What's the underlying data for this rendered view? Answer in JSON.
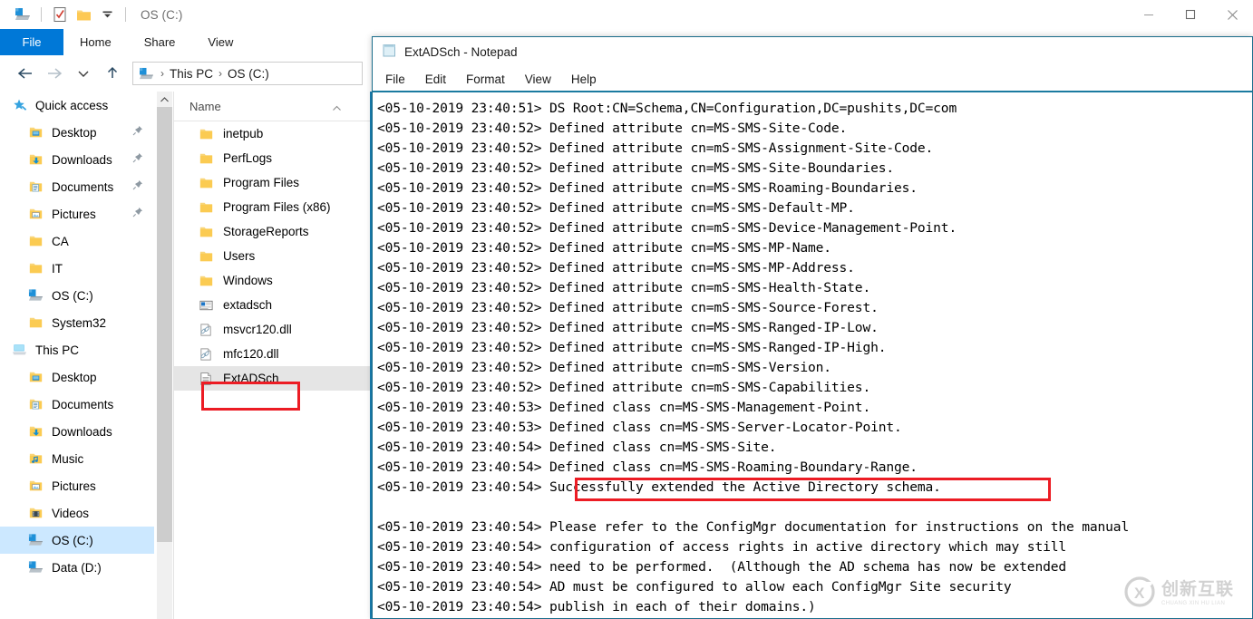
{
  "explorer": {
    "title": "OS (C:)",
    "quick_access_toolbar": [
      {
        "name": "drive-icon",
        "label": "OS (C:)"
      },
      {
        "name": "properties-icon",
        "label": "Properties"
      },
      {
        "name": "new-folder-icon",
        "label": "New folder"
      },
      {
        "name": "customize-dropdown-icon",
        "label": "Customize Quick Access Toolbar"
      }
    ],
    "window_controls": {
      "minimize": "—",
      "maximize": "□",
      "close": "✕"
    },
    "ribbon_tabs": [
      {
        "label": "File",
        "active": true
      },
      {
        "label": "Home",
        "active": false
      },
      {
        "label": "Share",
        "active": false
      },
      {
        "label": "View",
        "active": false
      }
    ],
    "address_bar": {
      "back": "Back",
      "forward": "Forward",
      "recent": "Recent locations",
      "up": "Up",
      "breadcrumbs": [
        "This PC",
        "OS (C:)"
      ],
      "separator": "›"
    },
    "navigation_pane": [
      {
        "label": "Quick access",
        "icon": "star-icon",
        "indent": 0,
        "pinned": false,
        "selected": false
      },
      {
        "label": "Desktop",
        "icon": "desktop-folder-icon",
        "indent": 1,
        "pinned": true,
        "selected": false
      },
      {
        "label": "Downloads",
        "icon": "downloads-folder-icon",
        "indent": 1,
        "pinned": true,
        "selected": false
      },
      {
        "label": "Documents",
        "icon": "documents-folder-icon",
        "indent": 1,
        "pinned": true,
        "selected": false
      },
      {
        "label": "Pictures",
        "icon": "pictures-folder-icon",
        "indent": 1,
        "pinned": true,
        "selected": false
      },
      {
        "label": "CA",
        "icon": "folder-icon",
        "indent": 1,
        "pinned": false,
        "selected": false
      },
      {
        "label": "IT",
        "icon": "folder-icon",
        "indent": 1,
        "pinned": false,
        "selected": false
      },
      {
        "label": "OS (C:)",
        "icon": "drive-icon",
        "indent": 1,
        "pinned": false,
        "selected": false
      },
      {
        "label": "System32",
        "icon": "folder-icon",
        "indent": 1,
        "pinned": false,
        "selected": false
      },
      {
        "label": "This PC",
        "icon": "thispc-icon",
        "indent": 0,
        "pinned": false,
        "selected": false
      },
      {
        "label": "Desktop",
        "icon": "desktop-folder-icon",
        "indent": 1,
        "pinned": false,
        "selected": false
      },
      {
        "label": "Documents",
        "icon": "documents-folder-icon",
        "indent": 1,
        "pinned": false,
        "selected": false
      },
      {
        "label": "Downloads",
        "icon": "downloads-folder-icon",
        "indent": 1,
        "pinned": false,
        "selected": false
      },
      {
        "label": "Music",
        "icon": "music-folder-icon",
        "indent": 1,
        "pinned": false,
        "selected": false
      },
      {
        "label": "Pictures",
        "icon": "pictures-folder-icon",
        "indent": 1,
        "pinned": false,
        "selected": false
      },
      {
        "label": "Videos",
        "icon": "videos-folder-icon",
        "indent": 1,
        "pinned": false,
        "selected": false
      },
      {
        "label": "OS (C:)",
        "icon": "drive-icon",
        "indent": 1,
        "pinned": false,
        "selected": true
      },
      {
        "label": "Data (D:)",
        "icon": "drive-icon",
        "indent": 1,
        "pinned": false,
        "selected": false
      }
    ],
    "file_list": {
      "column_header": "Name",
      "sort_indicator": "ascending",
      "items": [
        {
          "label": "inetpub",
          "icon": "folder-icon",
          "selected": false,
          "highlighted": false
        },
        {
          "label": "PerfLogs",
          "icon": "folder-icon",
          "selected": false,
          "highlighted": false
        },
        {
          "label": "Program Files",
          "icon": "folder-icon",
          "selected": false,
          "highlighted": false
        },
        {
          "label": "Program Files (x86)",
          "icon": "folder-icon",
          "selected": false,
          "highlighted": false
        },
        {
          "label": "StorageReports",
          "icon": "folder-icon",
          "selected": false,
          "highlighted": false
        },
        {
          "label": "Users",
          "icon": "folder-icon",
          "selected": false,
          "highlighted": false
        },
        {
          "label": "Windows",
          "icon": "folder-icon",
          "selected": false,
          "highlighted": false
        },
        {
          "label": "extadsch",
          "icon": "application-icon",
          "selected": false,
          "highlighted": false
        },
        {
          "label": "msvcr120.dll",
          "icon": "dll-icon",
          "selected": false,
          "highlighted": false
        },
        {
          "label": "mfc120.dll",
          "icon": "dll-icon",
          "selected": false,
          "highlighted": false
        },
        {
          "label": "ExtADSch",
          "icon": "textfile-icon",
          "selected": true,
          "highlighted": true
        }
      ]
    }
  },
  "notepad": {
    "title": "ExtADSch - Notepad",
    "icon": "notepad-icon",
    "menu": [
      "File",
      "Edit",
      "Format",
      "View",
      "Help"
    ],
    "highlight_line_index": 19,
    "lines": [
      "<05-10-2019 23:40:51> DS Root:CN=Schema,CN=Configuration,DC=pushits,DC=com",
      "<05-10-2019 23:40:52> Defined attribute cn=MS-SMS-Site-Code.",
      "<05-10-2019 23:40:52> Defined attribute cn=mS-SMS-Assignment-Site-Code.",
      "<05-10-2019 23:40:52> Defined attribute cn=MS-SMS-Site-Boundaries.",
      "<05-10-2019 23:40:52> Defined attribute cn=MS-SMS-Roaming-Boundaries.",
      "<05-10-2019 23:40:52> Defined attribute cn=MS-SMS-Default-MP.",
      "<05-10-2019 23:40:52> Defined attribute cn=mS-SMS-Device-Management-Point.",
      "<05-10-2019 23:40:52> Defined attribute cn=MS-SMS-MP-Name.",
      "<05-10-2019 23:40:52> Defined attribute cn=MS-SMS-MP-Address.",
      "<05-10-2019 23:40:52> Defined attribute cn=mS-SMS-Health-State.",
      "<05-10-2019 23:40:52> Defined attribute cn=mS-SMS-Source-Forest.",
      "<05-10-2019 23:40:52> Defined attribute cn=MS-SMS-Ranged-IP-Low.",
      "<05-10-2019 23:40:52> Defined attribute cn=MS-SMS-Ranged-IP-High.",
      "<05-10-2019 23:40:52> Defined attribute cn=mS-SMS-Version.",
      "<05-10-2019 23:40:52> Defined attribute cn=mS-SMS-Capabilities.",
      "<05-10-2019 23:40:53> Defined class cn=MS-SMS-Management-Point.",
      "<05-10-2019 23:40:53> Defined class cn=MS-SMS-Server-Locator-Point.",
      "<05-10-2019 23:40:54> Defined class cn=MS-SMS-Site.",
      "<05-10-2019 23:40:54> Defined class cn=MS-SMS-Roaming-Boundary-Range.",
      "<05-10-2019 23:40:54> Successfully extended the Active Directory schema.",
      "",
      "<05-10-2019 23:40:54> Please refer to the ConfigMgr documentation for instructions on the manual",
      "<05-10-2019 23:40:54> configuration of access rights in active directory which may still",
      "<05-10-2019 23:40:54> need to be performed.  (Although the AD schema has now be extended",
      "<05-10-2019 23:40:54> AD must be configured to allow each ConfigMgr Site security",
      "<05-10-2019 23:40:54> publish in each of their domains.)"
    ]
  },
  "annotations": {
    "file_highlight_color": "#ec1c24",
    "message_highlight_color": "#ec1c24"
  },
  "watermark": {
    "cn": "创新互联",
    "pinyin": "CHUANG XIN HU LIAN",
    "logo": "cx-logo-icon"
  }
}
